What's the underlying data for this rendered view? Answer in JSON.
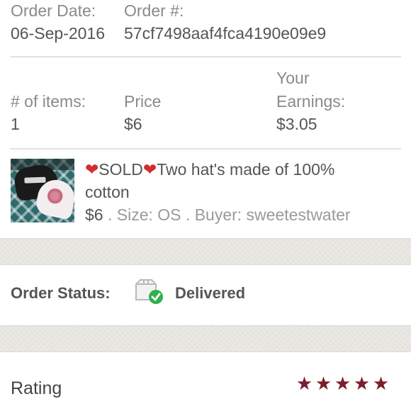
{
  "order": {
    "date_label": "Order Date:",
    "date_value": "06-Sep-2016",
    "number_label": "Order #:",
    "number_value": "57cf7498aaf4fca4190e09e9"
  },
  "summary": {
    "items_label": "# of items:",
    "items_value": "1",
    "price_label": "Price",
    "price_value": "$6",
    "earnings_label_line1": "Your",
    "earnings_label_line2": "Earnings:",
    "earnings_value": "$3.05"
  },
  "item": {
    "title_heart1": "❤",
    "title_sold": "SOLD",
    "title_heart2": "❤",
    "title_rest": "Two hat's made of 100%",
    "title_line2": "cotton",
    "price": "$6",
    "details": " . Size: OS . Buyer: sweetestwater"
  },
  "status": {
    "label": "Order Status:",
    "value": "Delivered",
    "icon": "delivered-box-icon"
  },
  "rating": {
    "label": "Rating",
    "stars": 5,
    "max": 5,
    "star_glyph": "★",
    "star_color": "#7a1e2c"
  }
}
